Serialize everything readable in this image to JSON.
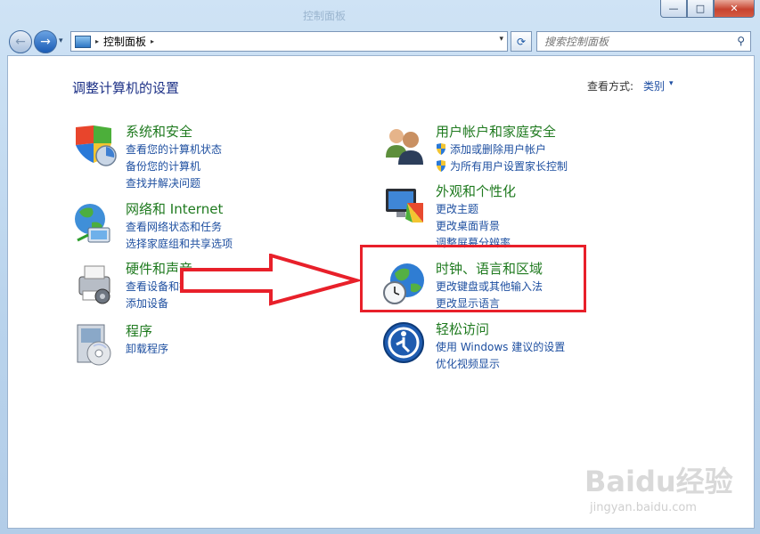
{
  "window": {
    "title": "控制面板",
    "min": "—",
    "max": "□",
    "close": "✕"
  },
  "nav": {
    "back": "←",
    "forward": "→",
    "dropdown": "▾"
  },
  "address": {
    "sep1": "▸",
    "crumb": "控制面板",
    "sep2": "▸",
    "dropdown": "▾"
  },
  "refresh": "⟳",
  "search": {
    "placeholder": "搜索控制面板",
    "icon": "⚲"
  },
  "content": {
    "title": "调整计算机的设置",
    "view_by_label": "查看方式:",
    "view_by_value": "类别",
    "view_by_arrow": "▾"
  },
  "categories_left": [
    {
      "title": "系统和安全",
      "icon": "system-security-icon",
      "links": [
        "查看您的计算机状态",
        "备份您的计算机",
        "查找并解决问题"
      ]
    },
    {
      "title": "网络和 Internet",
      "icon": "network-internet-icon",
      "links": [
        "查看网络状态和任务",
        "选择家庭组和共享选项"
      ]
    },
    {
      "title": "硬件和声音",
      "icon": "hardware-sound-icon",
      "links": [
        "查看设备和打印机",
        "添加设备"
      ]
    },
    {
      "title": "程序",
      "icon": "programs-icon",
      "links": [
        "卸载程序"
      ]
    }
  ],
  "categories_right": [
    {
      "title": "用户帐户和家庭安全",
      "icon": "user-accounts-icon",
      "links": [
        "添加或删除用户帐户",
        "为所有用户设置家长控制"
      ]
    },
    {
      "title": "外观和个性化",
      "icon": "appearance-icon",
      "links": [
        "更改主题",
        "更改桌面背景",
        "调整屏幕分辨率"
      ]
    },
    {
      "title": "时钟、语言和区域",
      "icon": "clock-language-region-icon",
      "links": [
        "更改键盘或其他输入法",
        "更改显示语言"
      ]
    },
    {
      "title": "轻松访问",
      "icon": "ease-of-access-icon",
      "links": [
        "使用 Windows 建议的设置",
        "优化视频显示"
      ]
    }
  ],
  "watermark": {
    "logo": "Baidu经验",
    "url": "jingyan.baidu.com"
  },
  "colors": {
    "category_title": "#1f7a1f",
    "link": "#1e4fa0",
    "page_title": "#1e3287",
    "annotation": "#e8202a"
  }
}
